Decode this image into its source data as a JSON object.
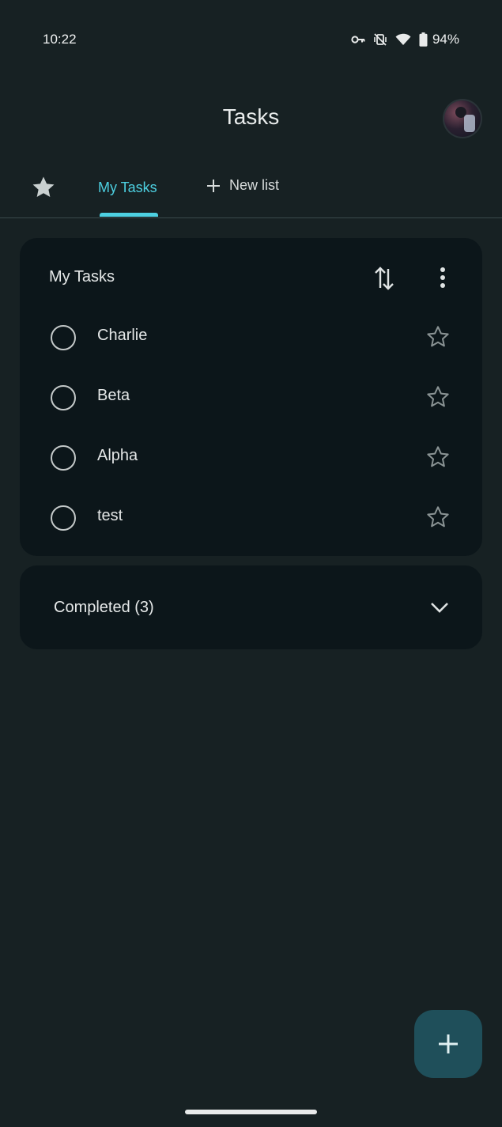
{
  "status_bar": {
    "time": "10:22",
    "battery_percent": "94%",
    "icons": [
      "vpn-key-icon",
      "vibrate-off-icon",
      "wifi-icon",
      "battery-icon"
    ]
  },
  "header": {
    "title": "Tasks",
    "avatar": "user-avatar"
  },
  "tabs": {
    "starred_icon": "star-filled-icon",
    "active": "My Tasks",
    "new_list": "New list"
  },
  "task_list": {
    "title": "My Tasks",
    "tasks": [
      {
        "title": "Charlie",
        "starred": false
      },
      {
        "title": "Beta",
        "starred": false
      },
      {
        "title": "Alpha",
        "starred": false
      },
      {
        "title": "test",
        "starred": false
      }
    ]
  },
  "completed": {
    "label": "Completed (3)"
  },
  "colors": {
    "background": "#172123",
    "card": "#0c161a",
    "accent": "#4dd0e1",
    "fab": "#1f4f5a"
  }
}
